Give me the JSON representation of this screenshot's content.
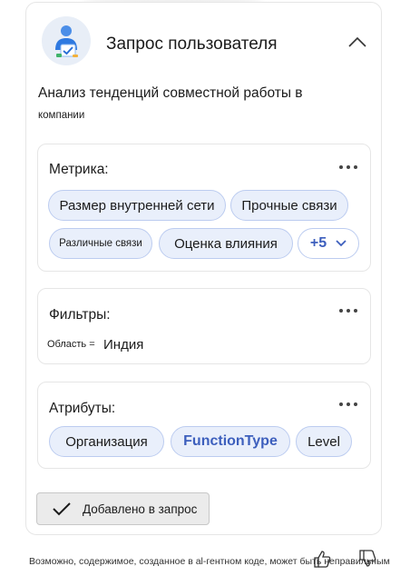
{
  "header": {
    "title": "Запрос пользователя",
    "avatar_icon": "user-check-icon",
    "collapse_icon": "chevron-up-icon"
  },
  "summary": {
    "line1": "Анализ тенденций совместной работы в",
    "line2": "компании"
  },
  "metrics": {
    "title": "Метрика:",
    "chips": [
      "Размер внутренней сети",
      "Прочные связи",
      "Различные связи",
      "Оценка влияния"
    ],
    "more_chip": "+5"
  },
  "filters": {
    "title": "Фильтры:",
    "key": "Область =",
    "value": "Индия"
  },
  "attributes": {
    "title": "Атрибуты:",
    "chips": [
      "Организация",
      "FunctionType",
      "Level"
    ]
  },
  "added_button": {
    "label": "Добавлено в запрос",
    "icon": "checkmark-icon"
  },
  "footer": {
    "disclaimer": "Возможно, содержимое, созданное в al-гентном коде, может быть неправильным"
  },
  "colors": {
    "chip_bg": "#e9effb",
    "chip_border": "#bcccf0",
    "accent": "#3d5fbd",
    "button_bg": "#ebebeb"
  }
}
